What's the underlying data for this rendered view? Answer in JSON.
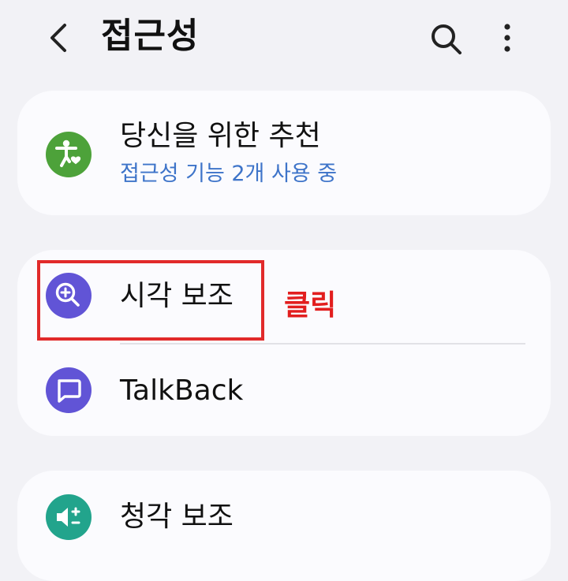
{
  "header": {
    "title": "접근성"
  },
  "cards": {
    "recommend": {
      "title": "당신을 위한 추천",
      "subtitle": "접근성 기능 2개 사용 중"
    },
    "vision": {
      "title": "시각 보조"
    },
    "talkback": {
      "title": "TalkBack"
    },
    "hearing": {
      "title": "청각 보조"
    }
  },
  "annotation": {
    "label": "클릭"
  },
  "colors": {
    "recommend_icon": "#4da23a",
    "vision_icon": "#6154d6",
    "talkback_icon": "#6154d6",
    "hearing_icon": "#22a48c",
    "subtitle": "#3e74c9",
    "highlight": "#e12a2a"
  },
  "icons": {
    "back": "chevron-left-icon",
    "search": "search-icon",
    "more": "more-vertical-icon",
    "recommend": "accessibility-heart-icon",
    "vision": "zoom-in-icon",
    "talkback": "speech-bubble-icon",
    "hearing": "speaker-plus-minus-icon"
  }
}
